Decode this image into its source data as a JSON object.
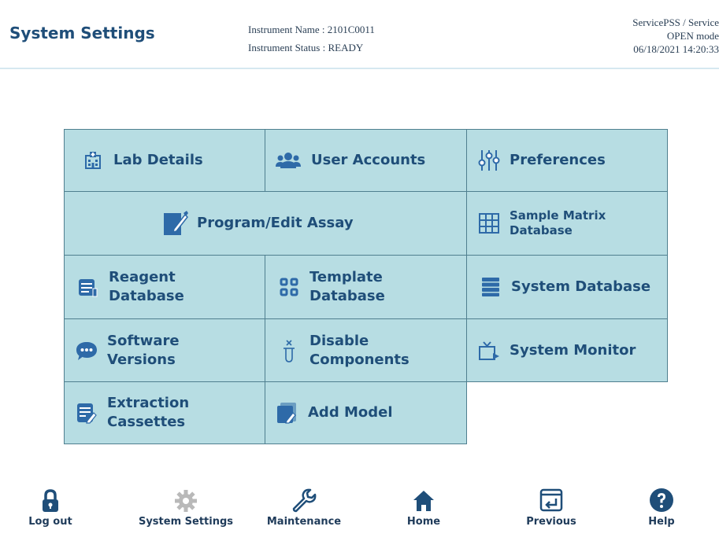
{
  "header": {
    "title": "System Settings",
    "instrument_name": "Instrument Name : 2101C0011",
    "instrument_status": "Instrument Status : READY",
    "user": "ServicePSS / Service",
    "mode": "OPEN mode",
    "datetime": "06/18/2021 14:20:33"
  },
  "tiles": {
    "lab_details": "Lab Details",
    "user_accounts": "User Accounts",
    "preferences": "Preferences",
    "program_edit_assay": "Program/Edit Assay",
    "sample_matrix_l1": "Sample Matrix",
    "sample_matrix_l2": "Database",
    "reagent_l1": "Reagent",
    "reagent_l2": "Database",
    "template_l1": "Template",
    "template_l2": "Database",
    "system_database": "System Database",
    "software_l1": "Software",
    "software_l2": "Versions",
    "disable_l1": "Disable",
    "disable_l2": "Components",
    "system_monitor": "System Monitor",
    "extraction_l1": "Extraction",
    "extraction_l2": "Cassettes",
    "add_model": "Add Model"
  },
  "bottom_nav": {
    "logout": "Log out",
    "system_settings": "System Settings",
    "maintenance": "Maintenance",
    "home": "Home",
    "previous": "Previous",
    "help": "Help"
  },
  "colors": {
    "tile_bg": "#b7dde3",
    "tile_border": "#4f7f8f",
    "text_primary": "#1f4e79",
    "icon_primary": "#2e6aa8",
    "icon_disabled": "#b9b9b9"
  }
}
